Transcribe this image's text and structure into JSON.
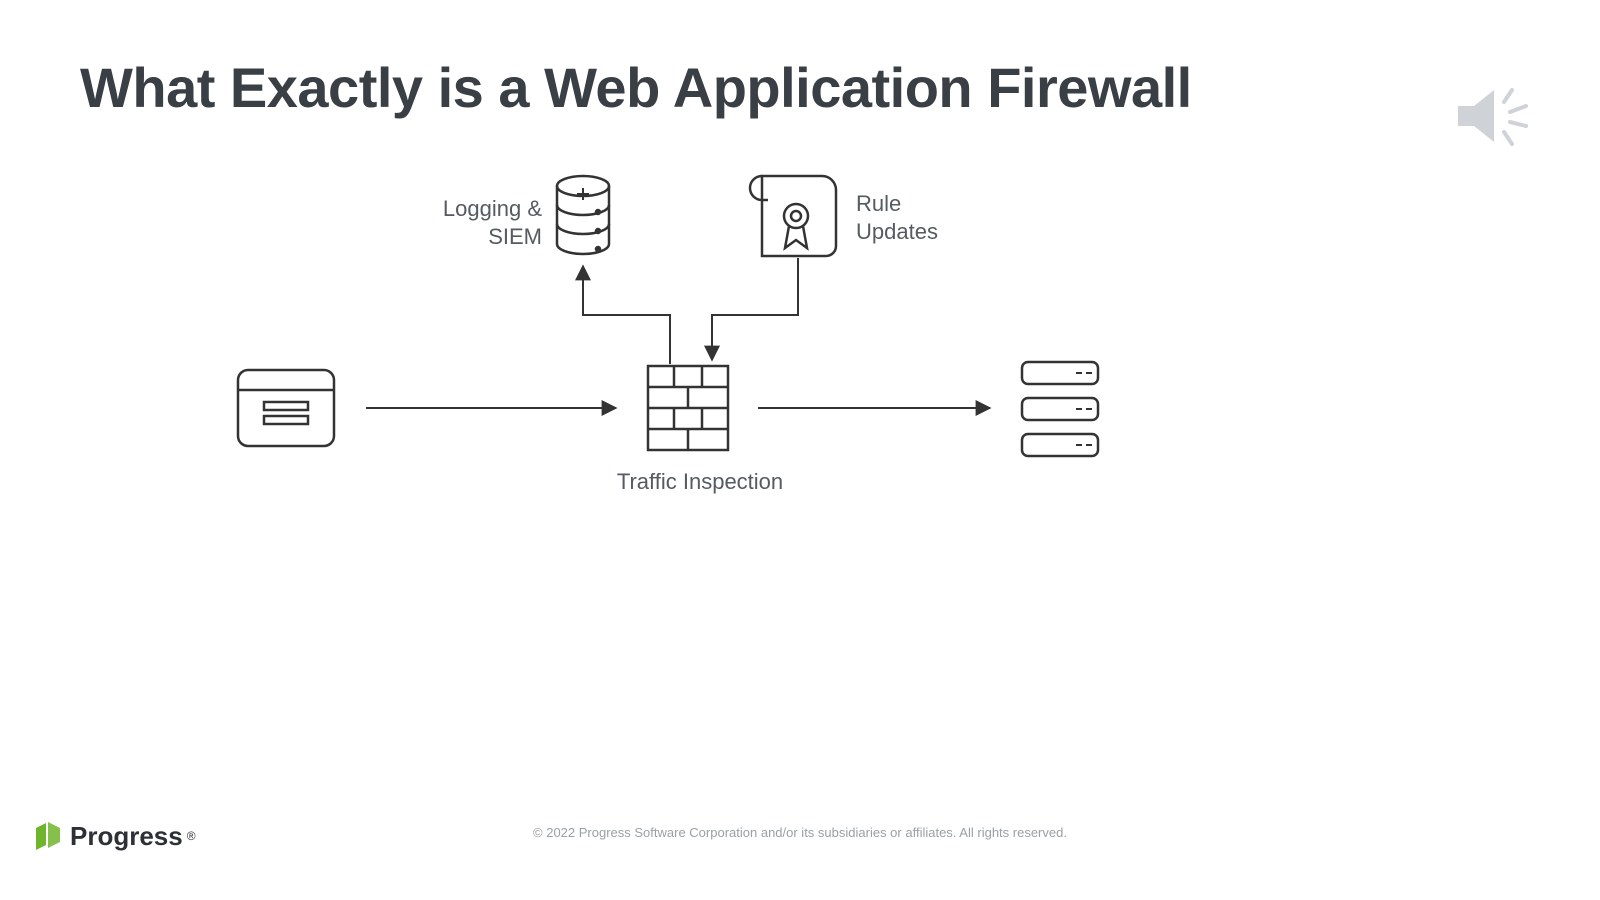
{
  "title": "What Exactly is a Web Application Firewall",
  "labels": {
    "logging": "Logging &\nSIEM",
    "rule": "Rule\nUpdates",
    "traffic": "Traffic Inspection"
  },
  "footer": "© 2022 Progress Software Corporation and/or its subsidiaries or affiliates. All rights reserved.",
  "brand": "Progress",
  "brand_tm": "®"
}
